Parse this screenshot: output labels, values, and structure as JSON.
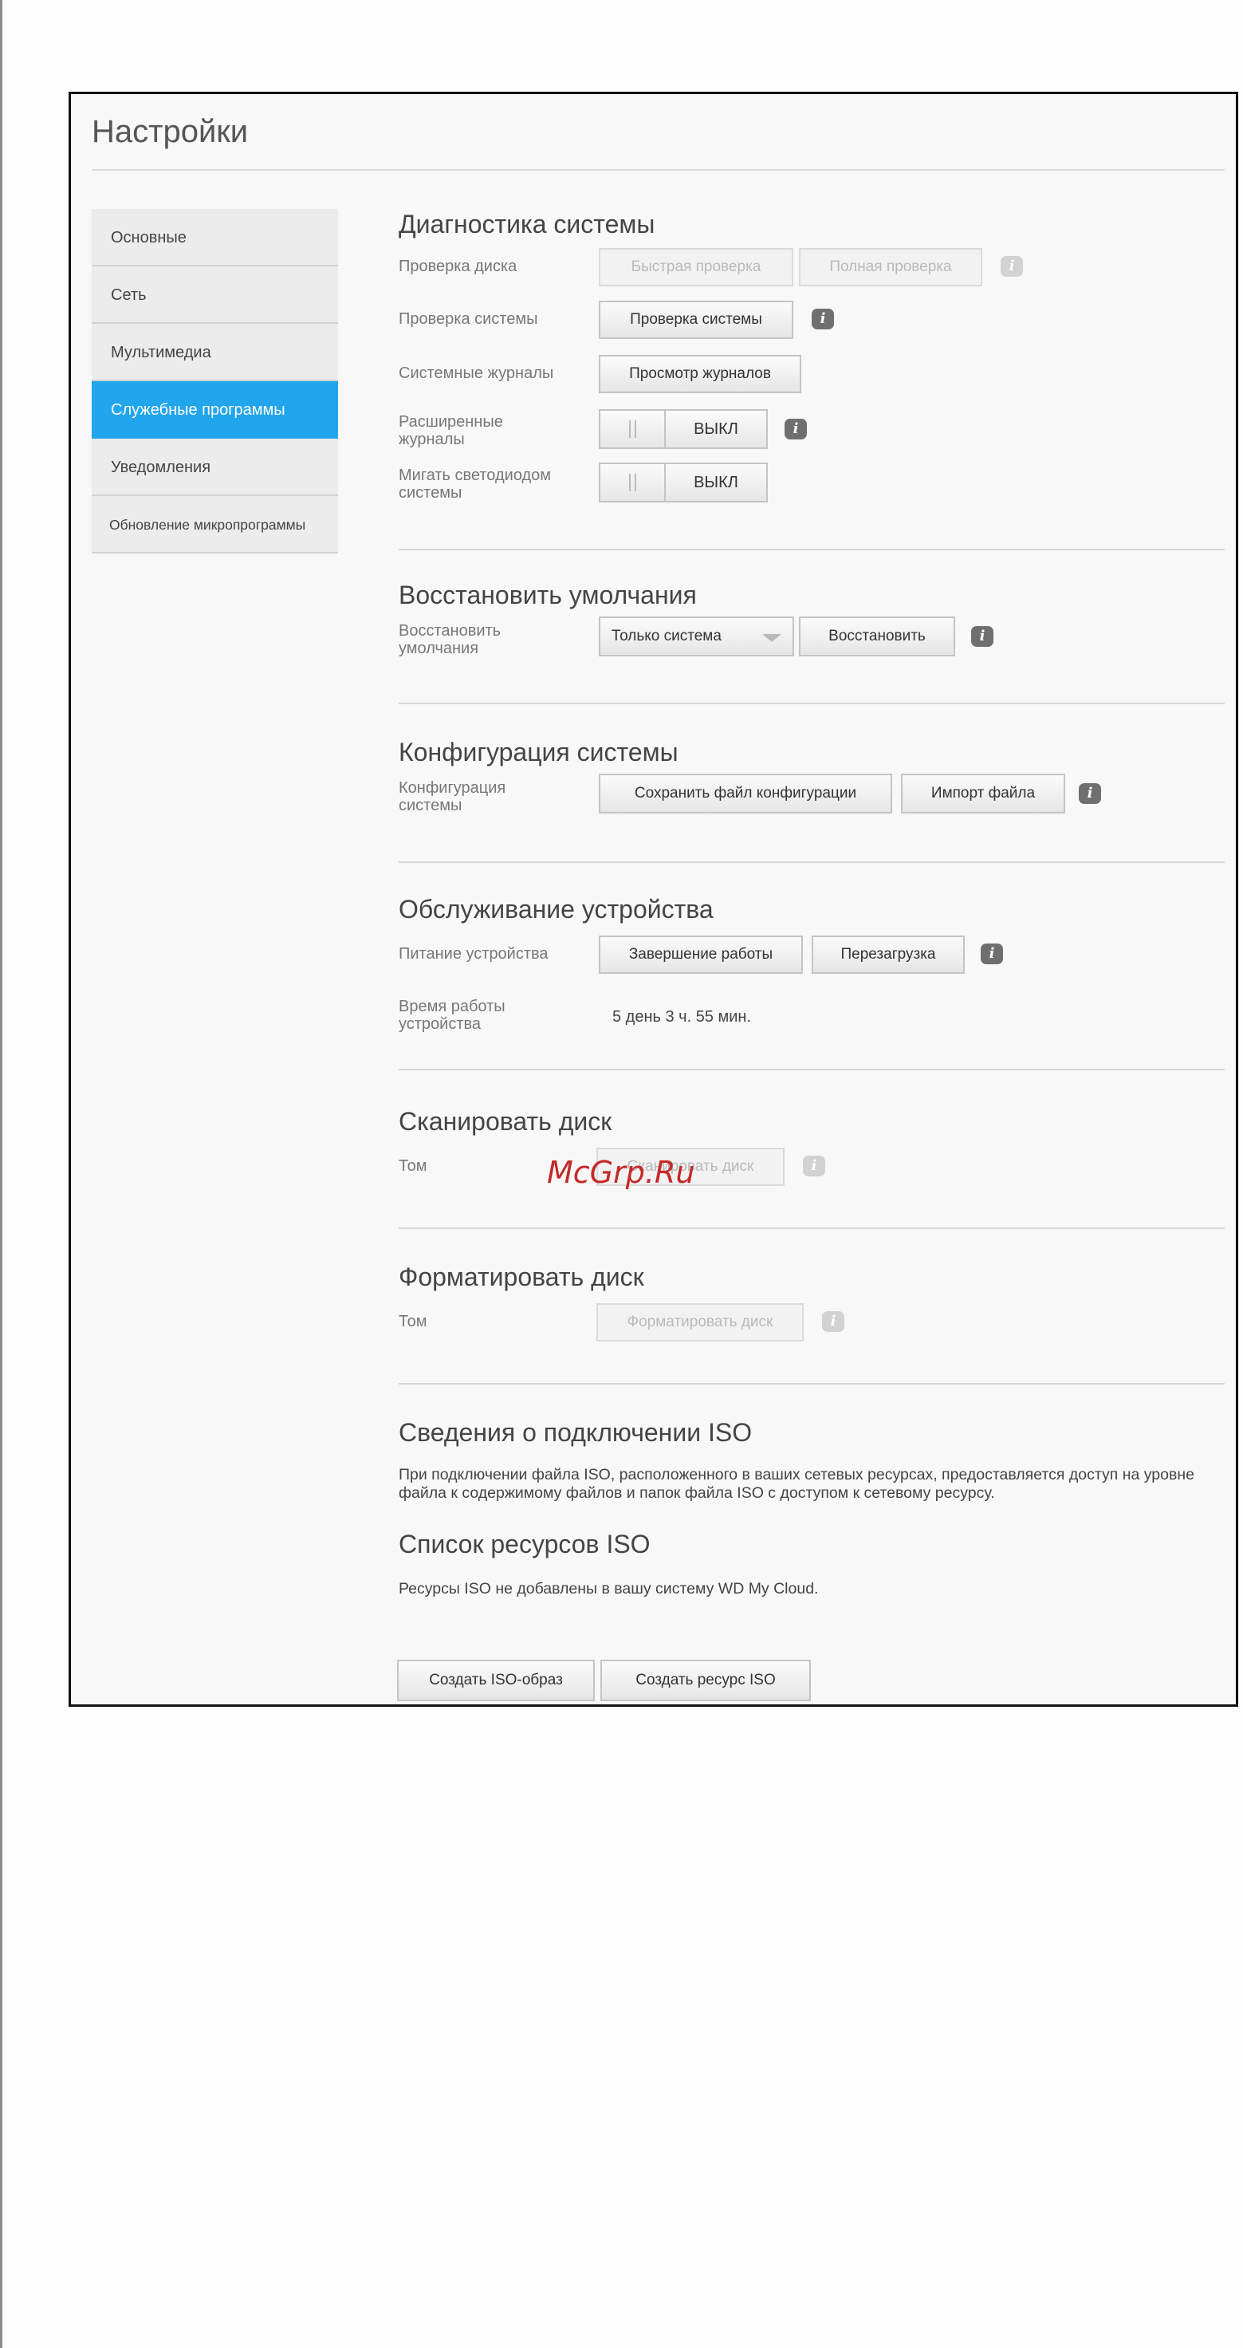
{
  "page": {
    "title": "Настройки"
  },
  "sidebar": {
    "items": [
      {
        "label": "Основные"
      },
      {
        "label": "Сеть"
      },
      {
        "label": "Мультимедиа"
      },
      {
        "label": "Служебные программы"
      },
      {
        "label": "Уведомления"
      },
      {
        "label": "Обновление микропрограммы"
      }
    ],
    "active_index": 3,
    "active_color": "#21a5ec"
  },
  "diagnostics": {
    "title": "Диагностика системы",
    "disk_check_label": "Проверка диска",
    "quick_check": "Быстрая проверка",
    "full_check": "Полная проверка",
    "system_check_label": "Проверка системы",
    "system_check_button": "Проверка системы",
    "logs_label": "Системные журналы",
    "logs_button": "Просмотр журналов",
    "extended_logs_label": "Расширенные журналы",
    "extended_logs_state": "ВЫКЛ",
    "blink_led_label": "Мигать светодиодом системы",
    "blink_led_state": "ВЫКЛ"
  },
  "restore": {
    "title": "Восстановить умолчания",
    "label": "Восстановить умолчания",
    "select_value": "Только система",
    "button": "Восстановить"
  },
  "config": {
    "title": "Конфигурация системы",
    "label": "Конфигурация системы",
    "save_button": "Сохранить файл конфигурации",
    "import_button": "Импорт файла"
  },
  "maintenance": {
    "title": "Обслуживание устройства",
    "power_label": "Питание устройства",
    "shutdown_button": "Завершение работы",
    "reboot_button": "Перезагрузка",
    "uptime_label": "Время работы устройства",
    "uptime_value": "5 день 3 ч. 55 мин."
  },
  "scan": {
    "title": "Сканировать диск",
    "volume_label": "Том",
    "button": "Сканировать диск"
  },
  "format": {
    "title": "Форматировать диск",
    "volume_label": "Том",
    "button": "Форматировать диск"
  },
  "iso": {
    "title": "Сведения о подключении ISO",
    "description": "При подключении файла ISO, расположенного в ваших сетевых ресурсах, предоставляется доступ на уровне файла к содержимому файлов и папок файла ISO с доступом к сетевому ресурсу.",
    "list_title": "Список ресурсов ISO",
    "empty_text": "Ресурсы ISO не добавлены в вашу систему WD My Cloud.",
    "create_image_button": "Создать ISO-образ",
    "create_share_button": "Создать ресурс ISO"
  },
  "watermark": {
    "text": "McGrp.Ru",
    "color": "#c62828"
  },
  "icons": {
    "info": "i"
  }
}
